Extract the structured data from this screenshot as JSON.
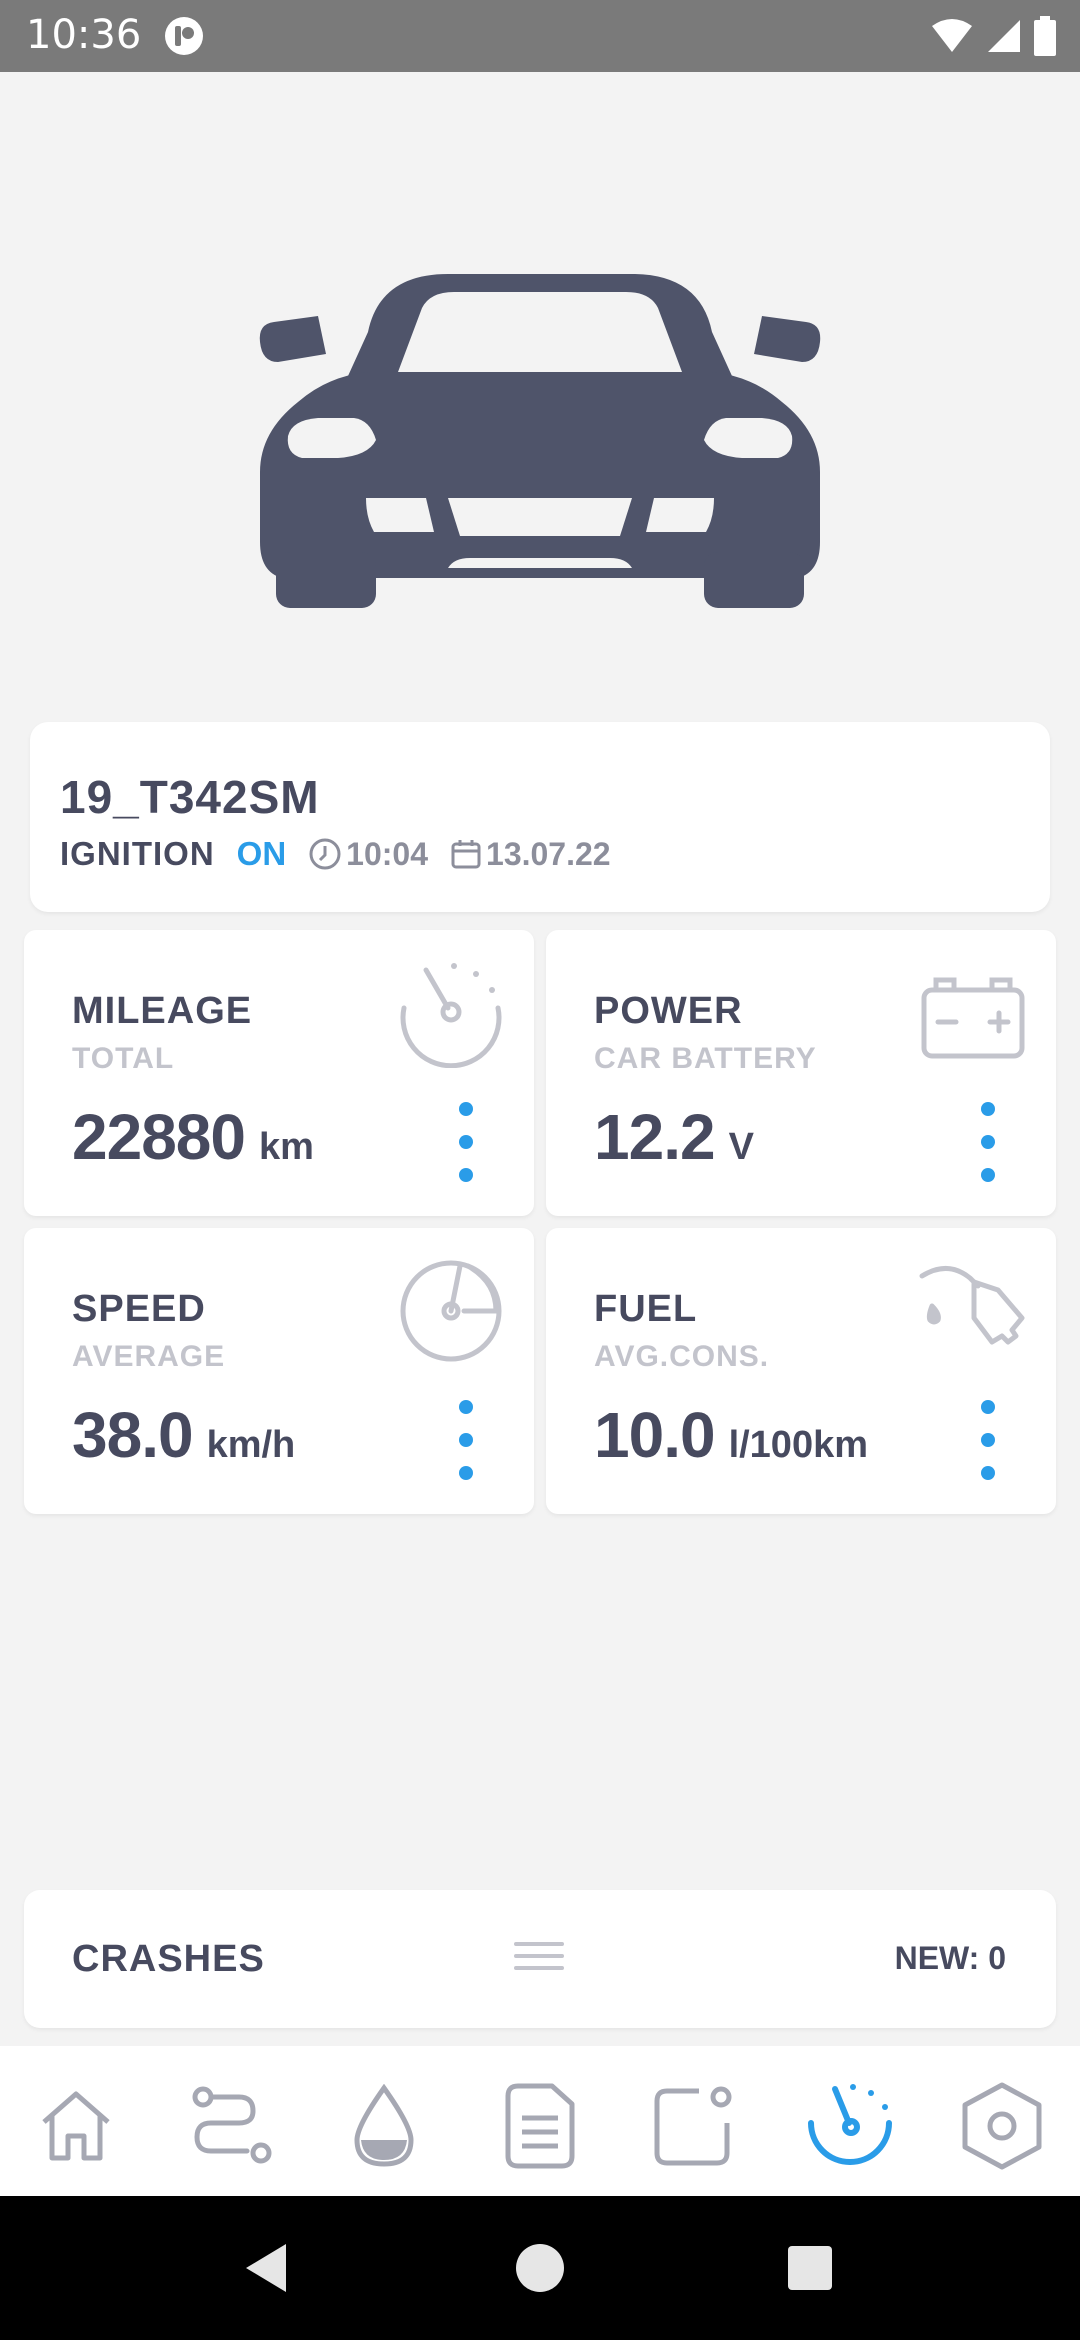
{
  "status_bar": {
    "time": "10:36"
  },
  "vehicle": {
    "plate": "19_T342SM",
    "ignition_label": "IGNITION",
    "ignition_state": "ON",
    "time": "10:04",
    "date": "13.07.22"
  },
  "tiles": [
    {
      "title": "MILEAGE",
      "subtitle": "TOTAL",
      "value": "22880",
      "unit": "km",
      "icon": "odometer-icon"
    },
    {
      "title": "POWER",
      "subtitle": "CAR BATTERY",
      "value": "12.2",
      "unit": "V",
      "icon": "battery-icon"
    },
    {
      "title": "SPEED",
      "subtitle": "AVERAGE",
      "value": "38.0",
      "unit": "km/h",
      "icon": "speedometer-icon"
    },
    {
      "title": "FUEL",
      "subtitle": "AVG.CONS.",
      "value": "10.0",
      "unit": "l/100km",
      "icon": "fuel-nozzle-icon"
    }
  ],
  "crashes": {
    "label": "CRASHES",
    "new": "NEW: 0"
  },
  "bottom_nav": {
    "items": [
      "home-icon",
      "route-icon",
      "drop-icon",
      "document-icon",
      "notification-icon",
      "dashboard-icon",
      "settings-icon"
    ],
    "active": "dashboard-icon"
  },
  "colors": {
    "accent": "#2a9ce8",
    "primary_text": "#474a5f",
    "muted_text": "#c3c4cc",
    "car": "#4f546a"
  }
}
